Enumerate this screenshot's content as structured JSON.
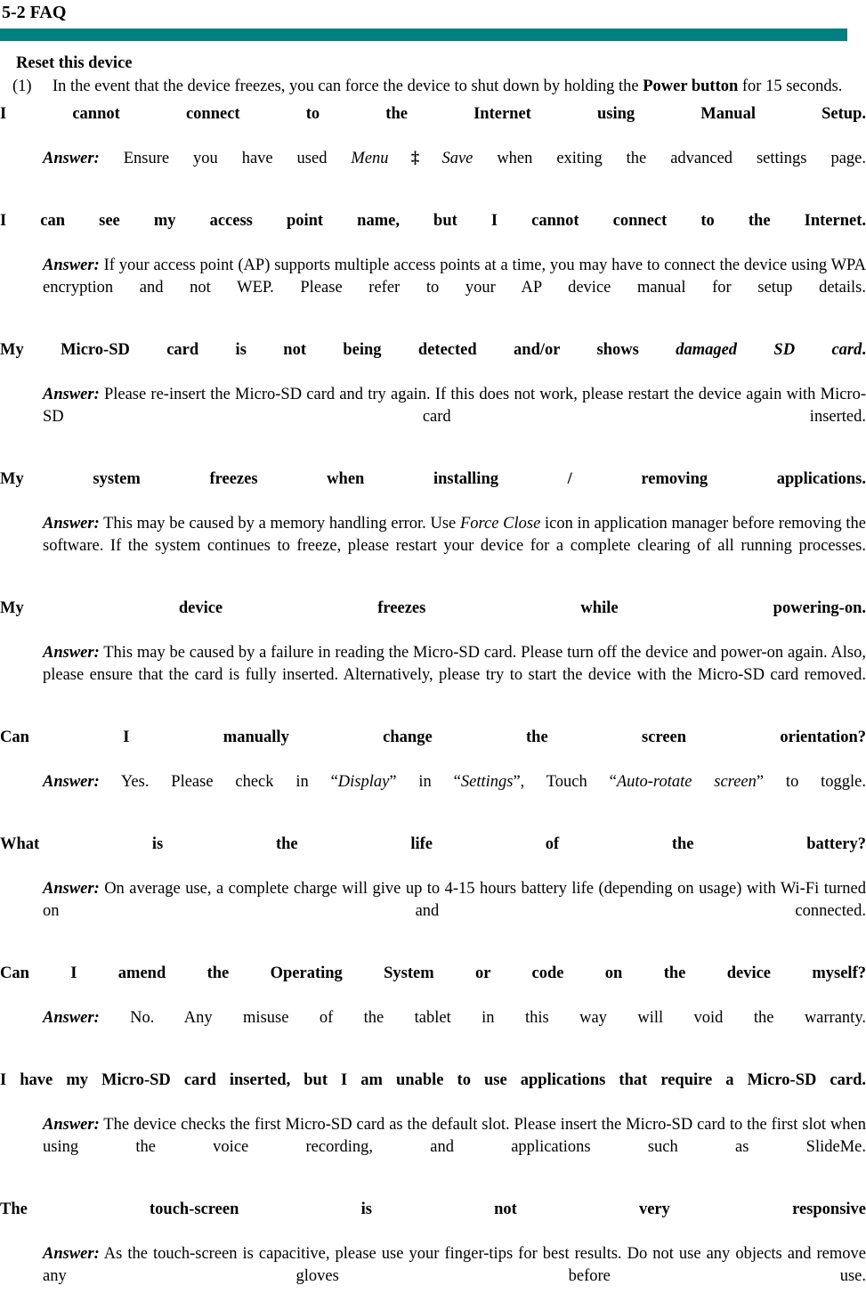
{
  "document": {
    "title": "5-2 FAQ",
    "accent_color": "#00807f"
  },
  "reset_section": {
    "heading": "Reset this device",
    "item_number": "(1)",
    "item_text_before": "In the event that the device freezes, you can force the device to shut down by holding the ",
    "item_text_bold": "Power button",
    "item_text_after": " for 15 seconds."
  },
  "faqs": [
    {
      "question": "I cannot connect to the Internet using Manual Setup.",
      "answer_label": "Answer:",
      "answer_parts": [
        {
          "type": "text",
          "value": " Ensure you have used "
        },
        {
          "type": "italic",
          "value": "Menu"
        },
        {
          "type": "arrow",
          "value": "‡"
        },
        {
          "type": "italic",
          "value": "Save"
        },
        {
          "type": "text",
          "value": " when exiting the advanced settings page."
        }
      ]
    },
    {
      "question": "I can see my access point name, but I cannot connect to the Internet.",
      "answer_label": "Answer:",
      "answer_parts": [
        {
          "type": "text",
          "value": " If your access point (AP) supports multiple access points at a time, you may have to connect the device using WPA encryption and not WEP.  Please refer to your AP device manual for setup details."
        }
      ]
    },
    {
      "question_parts": [
        {
          "type": "text",
          "value": "My Micro-SD card is not being detected and/or shows "
        },
        {
          "type": "italic",
          "value": "damaged SD card"
        },
        {
          "type": "text",
          "value": "."
        }
      ],
      "question": "My Micro-SD card is not being detected and/or shows damaged SD card.",
      "answer_label": "Answer:",
      "answer_parts": [
        {
          "type": "text",
          "value": " Please re-insert the Micro-SD card and try again.  If this does not work, please restart the device again with Micro-SD card inserted."
        }
      ]
    },
    {
      "question": "My system freezes when installing / removing applications.",
      "answer_label": "Answer:",
      "answer_parts": [
        {
          "type": "text",
          "value": " This may be caused by a memory handling error.  Use "
        },
        {
          "type": "italic",
          "value": "Force Close"
        },
        {
          "type": "text",
          "value": " icon in application manager before removing the software.  If the system continues to freeze, please restart your device for a complete clearing of all running processes."
        }
      ]
    },
    {
      "question": "My device freezes while powering-on.",
      "answer_label": "Answer:",
      "answer_parts": [
        {
          "type": "text",
          "value": " This may be caused by a failure in reading the Micro-SD card.  Please turn off the device and power-on again. Also, please ensure that the card is fully inserted.  Alternatively, please try to start the device with the Micro-SD card removed."
        }
      ]
    },
    {
      "question": "Can I manually change the screen orientation?",
      "answer_label": "Answer:",
      "answer_parts": [
        {
          "type": "text",
          "value": " Yes. Please check in “"
        },
        {
          "type": "italic",
          "value": "Display"
        },
        {
          "type": "text",
          "value": "” in “"
        },
        {
          "type": "italic",
          "value": "Settings"
        },
        {
          "type": "text",
          "value": "”, Touch “"
        },
        {
          "type": "italic",
          "value": "Auto-rotate screen"
        },
        {
          "type": "text",
          "value": "” to toggle."
        }
      ]
    },
    {
      "question": "What is the life of the battery?",
      "answer_label": "Answer:",
      "answer_parts": [
        {
          "type": "text",
          "value": " On average use, a complete charge will give up to 4-15 hours battery life (depending on usage) with Wi-Fi turned on and connected."
        }
      ]
    },
    {
      "question": "Can I amend the Operating System or code on the device myself?",
      "answer_label": "Answer:",
      "answer_parts": [
        {
          "type": "text",
          "value": " No.  Any misuse of the tablet in this way will void the warranty."
        }
      ]
    },
    {
      "question": "I have my Micro-SD card inserted, but I am unable to use applications that require a Micro-SD card.",
      "answer_label": "Answer:",
      "answer_parts": [
        {
          "type": "text",
          "value": " The device checks the first Micro-SD card as the default slot.  Please insert the Micro-SD card to the first slot when using the voice recording, and applications such as SlideMe."
        }
      ]
    },
    {
      "question": "The touch-screen is not very responsive",
      "answer_label": "Answer:",
      "answer_parts": [
        {
          "type": "text",
          "value": " As the touch-screen is capacitive, please use your finger-tips for best results. Do not use any objects and remove any gloves before use."
        }
      ]
    }
  ]
}
